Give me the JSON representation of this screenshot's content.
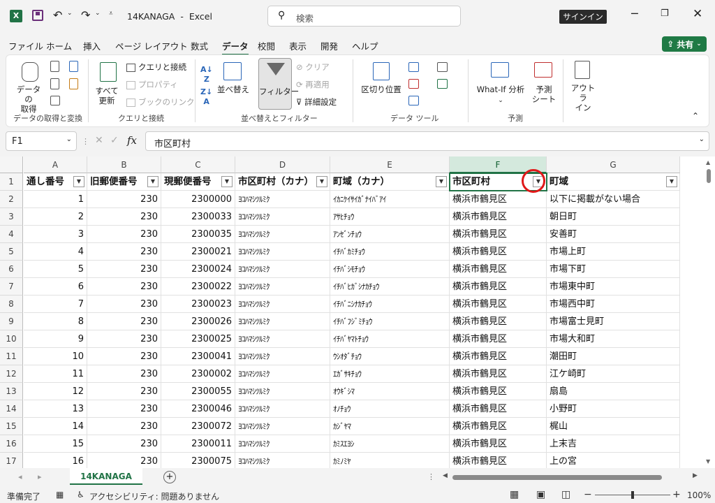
{
  "titlebar": {
    "filename": "14KANAGA",
    "separator": "-",
    "app": "Excel",
    "search_placeholder": "検索",
    "signin": "サインイン",
    "colors": {
      "accent": "#217346",
      "share": "#1f7a45"
    }
  },
  "menu": [
    "ファイル",
    "ホーム",
    "挿入",
    "ページ レイアウト",
    "数式",
    "データ",
    "校閲",
    "表示",
    "開発",
    "ヘルプ"
  ],
  "menu_active": "データ",
  "share_label": "共有",
  "ribbon": {
    "data_get": "データの\n取得",
    "refresh_all": "すべて\n更新",
    "queries": "クエリと接続",
    "properties": "プロパティ",
    "edit_links": "ブックのリンク",
    "sort": "並べ替え",
    "filter": "フィルター",
    "clear": "クリア",
    "reapply": "再適用",
    "advanced": "詳細設定",
    "text_to_columns": "区切り位置",
    "whatif": "What-If 分析",
    "forecast_sheet": "予測\nシート",
    "outline": "アウトラ\nイン",
    "groups": [
      "データの取得と変換",
      "クエリと接続",
      "並べ替えとフィルター",
      "データ ツール",
      "予測"
    ]
  },
  "formula_bar": {
    "name_box": "F1",
    "content": "市区町村",
    "fx": "fx"
  },
  "columns": [
    "A",
    "B",
    "C",
    "D",
    "E",
    "F",
    "G"
  ],
  "selected_column": "F",
  "headers": [
    "通し番号",
    "旧郵便番号",
    "現郵便番号",
    "市区町村（カナ）",
    "町域（カナ）",
    "市区町村",
    "町域"
  ],
  "rows": [
    [
      "1",
      "230",
      "2300000",
      "ﾖｺﾊﾏｼﾂﾙﾐｸ",
      "ｲｶﾆｹｲｻｲｶﾞﾅｲﾊﾞｱｲ",
      "横浜市鶴見区",
      "以下に掲載がない場合"
    ],
    [
      "2",
      "230",
      "2300033",
      "ﾖｺﾊﾏｼﾂﾙﾐｸ",
      "ｱｻﾋﾁｮｳ",
      "横浜市鶴見区",
      "朝日町"
    ],
    [
      "3",
      "230",
      "2300035",
      "ﾖｺﾊﾏｼﾂﾙﾐｸ",
      "ｱﾝｾﾞﾝﾁｮｳ",
      "横浜市鶴見区",
      "安善町"
    ],
    [
      "4",
      "230",
      "2300021",
      "ﾖｺﾊﾏｼﾂﾙﾐｸ",
      "ｲﾁﾊﾞｶﾐﾁｮｳ",
      "横浜市鶴見区",
      "市場上町"
    ],
    [
      "5",
      "230",
      "2300024",
      "ﾖｺﾊﾏｼﾂﾙﾐｸ",
      "ｲﾁﾊﾞｼﾓﾁｮｳ",
      "横浜市鶴見区",
      "市場下町"
    ],
    [
      "6",
      "230",
      "2300022",
      "ﾖｺﾊﾏｼﾂﾙﾐｸ",
      "ｲﾁﾊﾞﾋｶﾞｼﾅｶﾁｮｳ",
      "横浜市鶴見区",
      "市場東中町"
    ],
    [
      "7",
      "230",
      "2300023",
      "ﾖｺﾊﾏｼﾂﾙﾐｸ",
      "ｲﾁﾊﾞﾆｼﾅｶﾁｮｳ",
      "横浜市鶴見区",
      "市場西中町"
    ],
    [
      "8",
      "230",
      "2300026",
      "ﾖｺﾊﾏｼﾂﾙﾐｸ",
      "ｲﾁﾊﾞﾌｼﾞﾐﾁｮｳ",
      "横浜市鶴見区",
      "市場富士見町"
    ],
    [
      "9",
      "230",
      "2300025",
      "ﾖｺﾊﾏｼﾂﾙﾐｸ",
      "ｲﾁﾊﾞﾔﾏﾄﾁｮｳ",
      "横浜市鶴見区",
      "市場大和町"
    ],
    [
      "10",
      "230",
      "2300041",
      "ﾖｺﾊﾏｼﾂﾙﾐｸ",
      "ｳｼｵﾀﾞﾁｮｳ",
      "横浜市鶴見区",
      "潮田町"
    ],
    [
      "11",
      "230",
      "2300002",
      "ﾖｺﾊﾏｼﾂﾙﾐｸ",
      "ｴｶﾞｻｷﾁｮｳ",
      "横浜市鶴見区",
      "江ケ崎町"
    ],
    [
      "12",
      "230",
      "2300055",
      "ﾖｺﾊﾏｼﾂﾙﾐｸ",
      "ｵｳｷﾞｼﾏ",
      "横浜市鶴見区",
      "扇島"
    ],
    [
      "13",
      "230",
      "2300046",
      "ﾖｺﾊﾏｼﾂﾙﾐｸ",
      "ｵﾉﾁｮｳ",
      "横浜市鶴見区",
      "小野町"
    ],
    [
      "14",
      "230",
      "2300072",
      "ﾖｺﾊﾏｼﾂﾙﾐｸ",
      "ｶｼﾞﾔﾏ",
      "横浜市鶴見区",
      "梶山"
    ],
    [
      "15",
      "230",
      "2300011",
      "ﾖｺﾊﾏｼﾂﾙﾐｸ",
      "ｶﾐｽｴﾖｼ",
      "横浜市鶴見区",
      "上末吉"
    ],
    [
      "16",
      "230",
      "2300075",
      "ﾖｺﾊﾏｼﾂﾙﾐｸ",
      "ｶﾐﾉﾐﾔ",
      "横浜市鶴見区",
      "上の宮"
    ]
  ],
  "row_numbers": [
    "1",
    "2",
    "3",
    "4",
    "5",
    "6",
    "7",
    "8",
    "9",
    "10",
    "11",
    "12",
    "13",
    "14",
    "15",
    "16",
    "17"
  ],
  "sheet_tab": "14KANAGA",
  "status": {
    "ready": "準備完了",
    "accessibility": "アクセシビリティ: 問題ありません",
    "zoom": "100%"
  }
}
